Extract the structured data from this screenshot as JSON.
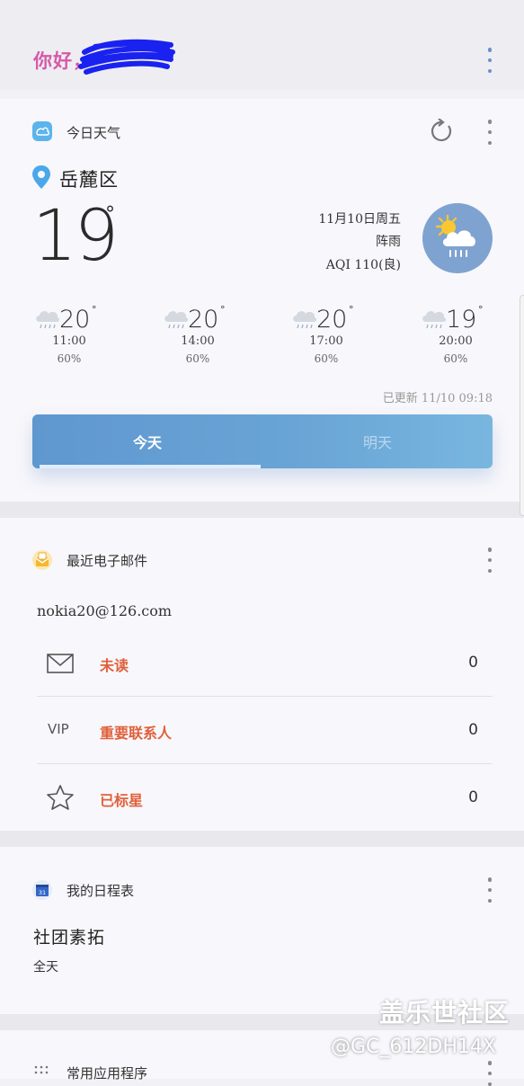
{
  "header": {
    "greeting": "你好，"
  },
  "weather": {
    "card_title": "今日天气",
    "location": "岳麓区",
    "current_temp": "19",
    "degree_symbol": "°",
    "date": "11月10日周五",
    "condition": "阵雨",
    "aqi": "AQI 110(良)",
    "hourly": [
      {
        "temp": "20",
        "time": "11:00",
        "precip": "60%"
      },
      {
        "temp": "20",
        "time": "14:00",
        "precip": "60%"
      },
      {
        "temp": "20",
        "time": "17:00",
        "precip": "60%"
      },
      {
        "temp": "19",
        "time": "20:00",
        "precip": "60%"
      }
    ],
    "updated": "已更新 11/10 09:18",
    "tabs": [
      "今天",
      "明天"
    ],
    "active_tab": "今天"
  },
  "email": {
    "card_title": "最近电子邮件",
    "account": "nokia20@126.com",
    "rows": [
      {
        "icon": "envelope-icon",
        "label": "未读",
        "count": "0"
      },
      {
        "icon": "VIP",
        "label": "重要联系人",
        "count": "0"
      },
      {
        "icon": "star-icon",
        "label": "已标星",
        "count": "0"
      }
    ]
  },
  "calendar": {
    "card_title": "我的日程表",
    "icon_text": "31",
    "event_title": "社团素拓",
    "event_time": "全天"
  },
  "apps": {
    "card_title": "常用应用程序"
  },
  "watermark": {
    "site": "盖乐世社区",
    "user": "@GC_612DH14X"
  },
  "colors": {
    "greeting": "#d55aa8",
    "accent_red": "#e0603a",
    "tab_blue": "#6aa5d6",
    "card_bg": "#f8f7fb"
  }
}
